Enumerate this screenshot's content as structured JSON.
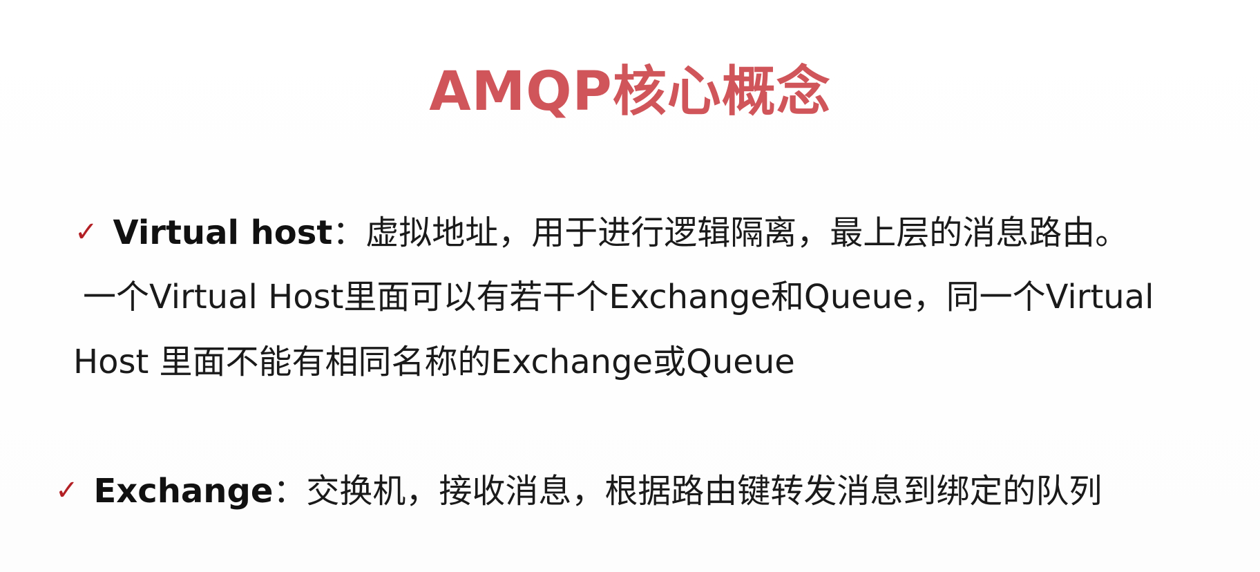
{
  "slide": {
    "title": "AMQP核心概念",
    "items": [
      {
        "term": "Virtual host",
        "separator": "：",
        "description": "虚拟地址，用于进行逻辑隔离，最上层的消息路由。",
        "details": [
          "一个Virtual Host里面可以有若干个Exchange和Queue，同一个Virtual",
          "Host 里面不能有相同名称的Exchange或Queue"
        ]
      },
      {
        "term": "Exchange",
        "separator": "：",
        "description": "交换机，接收消息，根据路由键转发消息到绑定的队列"
      }
    ],
    "check_icon": "checkmark-icon",
    "colors": {
      "title": "#d0555a",
      "check": "#b32025",
      "text": "#1a1a1a"
    }
  }
}
